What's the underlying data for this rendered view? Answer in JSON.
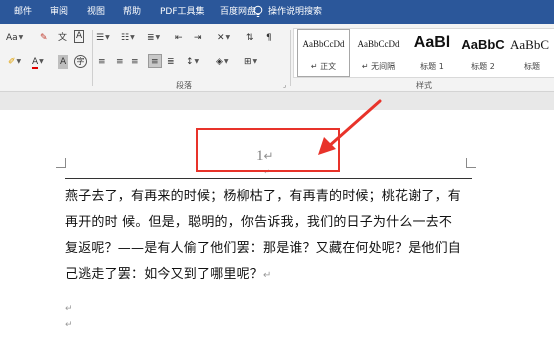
{
  "menubar": {
    "items": [
      "邮件",
      "审阅",
      "视图",
      "帮助",
      "PDF工具集",
      "百度网盘",
      "操作说明搜索"
    ]
  },
  "ribbon": {
    "font_group": {
      "font_size_label": "Aa",
      "font_color_label": "A",
      "char_shading_label": "A",
      "phonetic_label": "文",
      "char_border_label": "A",
      "enclose_label": "字"
    },
    "paragraph_group": {
      "label": "段落"
    },
    "styles_group": {
      "label": "样式",
      "styles": [
        {
          "preview": "AaBbCcDd",
          "name": "↵ 正文"
        },
        {
          "preview": "AaBbCcDd",
          "name": "↵ 无间隔"
        },
        {
          "preview": "AaBl",
          "name": "标题 1"
        },
        {
          "preview": "AaBbC",
          "name": "标题 2"
        },
        {
          "preview": "AaBbC",
          "name": "标题"
        }
      ]
    }
  },
  "document": {
    "page_number": "1",
    "paragraph_mark": "↵",
    "paragraph_lines": [
      "燕子去了，有再来的时候；杨柳枯了，有再青的时候；桃花谢了，有",
      "再开的时 候。但是，聪明的，你告诉我，我们的日子为什么一去不",
      "复返呢？——是有人偷了他们罢：那是谁？又藏在何处呢？是他们自",
      "己逃走了罢：如今又到了哪里呢？"
    ]
  },
  "annotation": {
    "color": "#e8332a"
  },
  "colors": {
    "menubar": "#2b579a",
    "ribbon": "#f3f3f3"
  }
}
